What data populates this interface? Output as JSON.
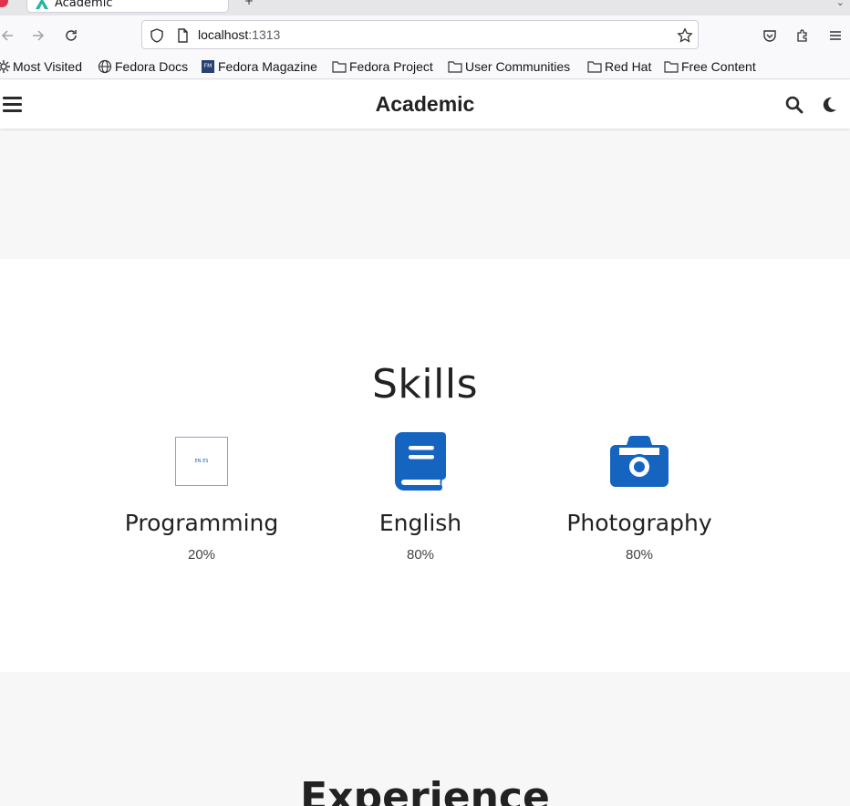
{
  "browser": {
    "tab_title": "Academic",
    "url_host": "localhost",
    "url_port": ":1313",
    "bookmarks": [
      {
        "label": "Most Visited",
        "icon": "gear-icon"
      },
      {
        "label": "Fedora Docs",
        "icon": "globe-icon"
      },
      {
        "label": "Fedora Magazine",
        "icon": "fedora-magazine-icon"
      },
      {
        "label": "Fedora Project",
        "icon": "folder-icon"
      },
      {
        "label": "User Communities",
        "icon": "folder-icon"
      },
      {
        "label": "Red Hat",
        "icon": "folder-icon"
      },
      {
        "label": "Free Content",
        "icon": "folder-icon"
      }
    ]
  },
  "site": {
    "brand": "Academic",
    "accent_color": "#1565c0"
  },
  "skills": {
    "title": "Skills",
    "items": [
      {
        "name": "Programming",
        "percent": "20%",
        "icon": "broken-image-icon",
        "icon_alt": "EN ES"
      },
      {
        "name": "English",
        "percent": "80%",
        "icon": "book-icon"
      },
      {
        "name": "Photography",
        "percent": "80%",
        "icon": "camera-icon"
      }
    ]
  },
  "experience": {
    "title": "Experience"
  }
}
